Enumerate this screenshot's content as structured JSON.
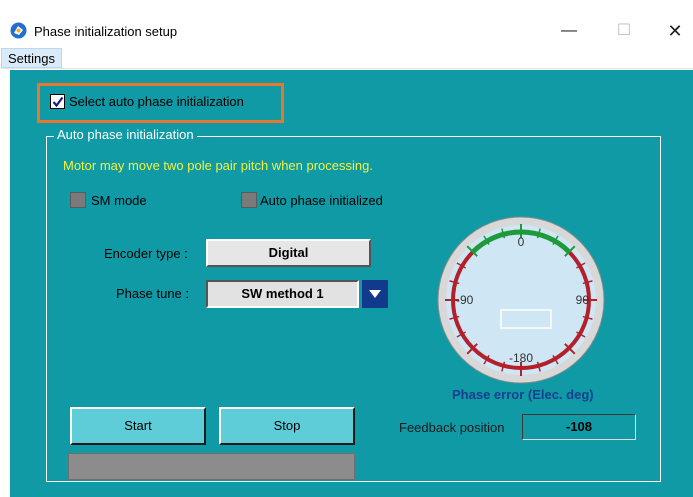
{
  "window": {
    "title": "Phase initialization setup",
    "minimize_glyph": "—",
    "maximize_glyph": "☐",
    "close_glyph": "✕",
    "icon": "app-logo-icon"
  },
  "menu": {
    "settings_label": "Settings"
  },
  "auto_select": {
    "label": "Select auto phase initialization",
    "checked": true,
    "highlight_color": "#e8762c"
  },
  "group": {
    "legend": "Auto phase initialization",
    "warning": "Motor may move two pole pair pitch when processing.",
    "sm_mode_label": "SM mode",
    "auto_phase_initialized_label": "Auto phase initialized",
    "encoder_type_label": "Encoder type :",
    "encoder_type_value": "Digital",
    "phase_tune_label": "Phase tune :",
    "phase_tune_value": "SW method 1",
    "dropdown_icon": "chevron-down-icon"
  },
  "gauge": {
    "label_top": "0",
    "label_left": "-90",
    "label_right": "90",
    "label_bottom": "-180",
    "caption": "Phase error (Elec. deg)",
    "readout": ""
  },
  "controls": {
    "start_label": "Start",
    "stop_label": "Stop",
    "progress": 0
  },
  "feedback": {
    "label": "Feedback position",
    "value": "-108"
  },
  "colors": {
    "panel": "#0f9aa5",
    "warning_text": "#f2f23c",
    "dropdown": "#123a8c",
    "caption": "#173f8f"
  }
}
